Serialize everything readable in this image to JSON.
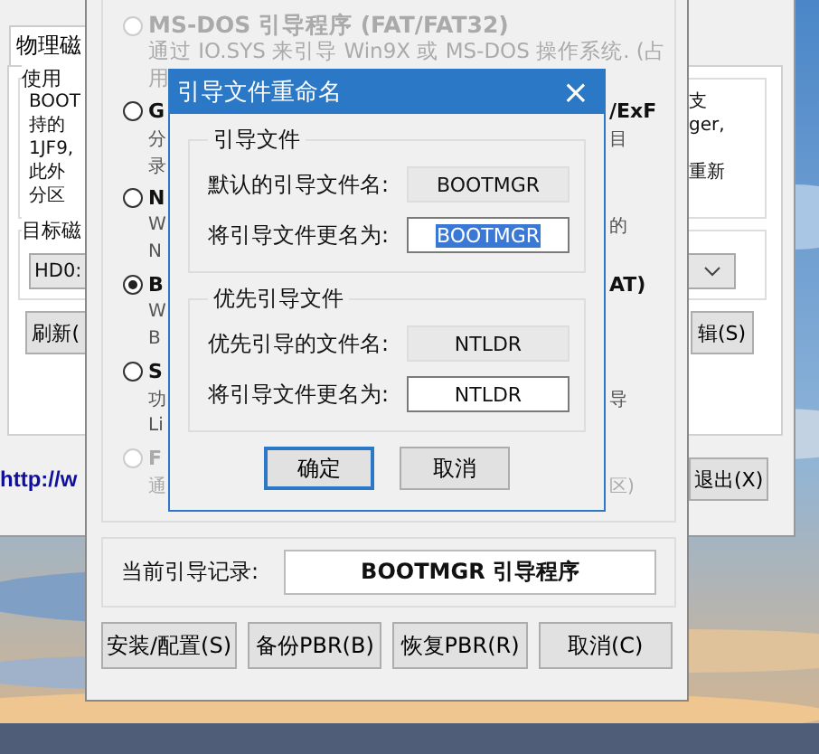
{
  "back_window": {
    "tabs": [
      {
        "label": "物理磁",
        "selected": true
      }
    ],
    "usage_group": {
      "label": "使用",
      "lines": [
        {
          "left": "BOOT",
          "right": "支"
        },
        {
          "left": "持的",
          "right": "ger,"
        },
        {
          "left": "1JF9,"
        },
        {
          "left": "此外",
          "right": "重新"
        },
        {
          "left": "分区"
        }
      ]
    },
    "target_group": {
      "label": "目标磁",
      "combo_value": "HD0:"
    },
    "buttons": [
      "刷新(",
      "辑(S)"
    ],
    "link": "http://w",
    "exit_button": "退出(X)"
  },
  "boot_window": {
    "options": [
      {
        "title": "MS-DOS 引导程序 (FAT/FAT32)",
        "selected": false,
        "disabled": true,
        "lines": [
          {
            "left": "通过 IO.SYS 来引导 Win9X 或 MS-DOS 操作系统. (占"
          },
          {
            "left": "用"
          }
        ]
      },
      {
        "title": "G",
        "title_right": "/ExF",
        "selected": false,
        "disabled": false,
        "lines": [
          {
            "left": "分",
            "right": "目"
          },
          {
            "left": "录"
          }
        ]
      },
      {
        "title": "N",
        "selected": false,
        "disabled": false,
        "lines": [
          {
            "left": "W",
            "right": "的"
          },
          {
            "left": "N"
          }
        ]
      },
      {
        "title": "B",
        "title_right": "AT)",
        "selected": true,
        "disabled": false,
        "lines": [
          {
            "left": "W"
          },
          {
            "left": "B"
          }
        ]
      },
      {
        "title": "S",
        "selected": false,
        "disabled": false,
        "lines": [
          {
            "left": "功",
            "right": "导"
          },
          {
            "left": "Li"
          }
        ]
      },
      {
        "title": "F",
        "selected": false,
        "disabled": true,
        "lines": [
          {
            "left": "通",
            "right": "区)"
          }
        ]
      }
    ],
    "current_label": "当前引导记录:",
    "current_value": "BOOTMGR 引导程序",
    "buttons": [
      "安装/配置(S)",
      "备份PBR(B)",
      "恢复PBR(R)",
      "取消(C)"
    ]
  },
  "dialog": {
    "title": "引导文件重命名",
    "close": "×",
    "groups": [
      {
        "label": "引导文件",
        "rows": [
          {
            "label": "默认的引导文件名:",
            "value": "BOOTMGR",
            "kind": "readonly"
          },
          {
            "label": "将引导文件更名为:",
            "value": "BOOTMGR",
            "kind": "selected-input"
          }
        ]
      },
      {
        "label": "优先引导文件",
        "rows": [
          {
            "label": "优先引导的文件名:",
            "value": "NTLDR",
            "kind": "readonly"
          },
          {
            "label": "将引导文件更名为:",
            "value": "NTLDR",
            "kind": "input"
          }
        ]
      }
    ],
    "buttons": [
      {
        "label": "确定",
        "default": true
      },
      {
        "label": "取消",
        "default": false
      }
    ]
  }
}
